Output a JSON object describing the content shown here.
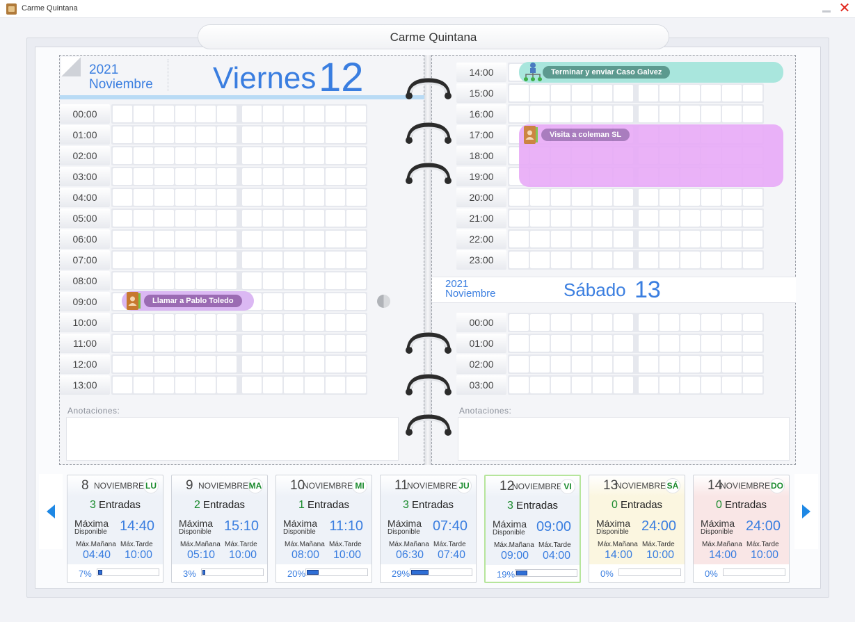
{
  "window": {
    "title": "Carme Quintana",
    "close_glyph": "✕"
  },
  "owner": {
    "name": "Carme Quintana"
  },
  "left_page": {
    "year": "2021",
    "month": "Noviembre",
    "day_name": "Viernes",
    "day_number": "12",
    "slots": [
      "00:00",
      "01:00",
      "02:00",
      "03:00",
      "04:00",
      "05:00",
      "06:00",
      "07:00",
      "08:00",
      "09:00",
      "10:00",
      "11:00",
      "12:00",
      "13:00"
    ],
    "notes_label": "Anotaciones:"
  },
  "right_page": {
    "slots_top": [
      "14:00",
      "15:00",
      "16:00",
      "17:00",
      "18:00",
      "19:00",
      "20:00",
      "21:00",
      "22:00",
      "23:00"
    ],
    "next_day": {
      "year": "2021",
      "month": "Noviembre",
      "day_name": "Sábado",
      "day_number": "13"
    },
    "slots_bottom": [
      "00:00",
      "01:00",
      "02:00",
      "03:00"
    ],
    "notes_label": "Anotaciones:"
  },
  "events": [
    {
      "label": "Llamar a Pablo Toledo",
      "icon": "contact-book-icon",
      "color": "#d9b3f2"
    },
    {
      "label": "Terminar y enviar  Caso Galvez",
      "icon": "org-chart-icon",
      "color": "#a7e5dc"
    },
    {
      "label": "Visita a coleman SL",
      "icon": "contact-book-icon",
      "color": "#e6a6f5"
    }
  ],
  "week": [
    {
      "day": "8",
      "month": "NOVIEMBRE",
      "dow": "LU",
      "entries_count": "3",
      "entries_label": "Entradas",
      "max_label": "Máxima",
      "disp_label": "Disponible",
      "max_time": "14:40",
      "am_label": "Máx.Mañana",
      "pm_label": "Máx.Tarde",
      "am_time": "04:40",
      "pm_time": "10:00",
      "pct": "7%",
      "fill": 0.07,
      "bg": "#eef2f8"
    },
    {
      "day": "9",
      "month": "NOVIEMBRE",
      "dow": "MA",
      "entries_count": "2",
      "entries_label": "Entradas",
      "max_label": "Máxima",
      "disp_label": "Disponible",
      "max_time": "15:10",
      "am_label": "Máx.Mañana",
      "pm_label": "Máx.Tarde",
      "am_time": "05:10",
      "pm_time": "10:00",
      "pct": "3%",
      "fill": 0.03,
      "bg": "#eef2f8"
    },
    {
      "day": "10",
      "month": "NOVIEMBRE",
      "dow": "MI",
      "entries_count": "1",
      "entries_label": "Entradas",
      "max_label": "Máxima",
      "disp_label": "Disponible",
      "max_time": "11:10",
      "am_label": "Máx.Mañana",
      "pm_label": "Máx.Tarde",
      "am_time": "08:00",
      "pm_time": "10:00",
      "pct": "20%",
      "fill": 0.2,
      "bg": "#eef2f8"
    },
    {
      "day": "11",
      "month": "NOVIEMBRE",
      "dow": "JU",
      "entries_count": "3",
      "entries_label": "Entradas",
      "max_label": "Máxima",
      "disp_label": "Disponible",
      "max_time": "07:40",
      "am_label": "Máx.Mañana",
      "pm_label": "Máx.Tarde",
      "am_time": "06:30",
      "pm_time": "07:40",
      "pct": "29%",
      "fill": 0.29,
      "bg": "#eef2f8"
    },
    {
      "day": "12",
      "month": "NOVIEMBRE",
      "dow": "VI",
      "entries_count": "3",
      "entries_label": "Entradas",
      "max_label": "Máxima",
      "disp_label": "Disponible",
      "max_time": "09:00",
      "am_label": "Máx.Mañana",
      "pm_label": "Máx.Tarde",
      "am_time": "09:00",
      "pm_time": "04:00",
      "pct": "19%",
      "fill": 0.19,
      "bg": "#eef2f8",
      "selected": true
    },
    {
      "day": "13",
      "month": "NOVIEMBRE",
      "dow": "SÁ",
      "entries_count": "0",
      "entries_label": "Entradas",
      "max_label": "Máxima",
      "disp_label": "Disponible",
      "max_time": "24:00",
      "am_label": "Máx.Mañana",
      "pm_label": "Máx.Tarde",
      "am_time": "14:00",
      "pm_time": "10:00",
      "pct": "0%",
      "fill": 0,
      "bg": "#fbf6e0"
    },
    {
      "day": "14",
      "month": "NOVIEMBRE",
      "dow": "DO",
      "entries_count": "0",
      "entries_label": "Entradas",
      "max_label": "Máxima",
      "disp_label": "Disponible",
      "max_time": "24:00",
      "am_label": "Máx.Mañana",
      "pm_label": "Máx.Tarde",
      "am_time": "14:00",
      "pm_time": "10:00",
      "pct": "0%",
      "fill": 0,
      "bg": "#f9e6e6"
    }
  ],
  "colors": {
    "accent": "#3a7ee0",
    "count_green": "#1b8b2e",
    "selected_border": "#b6e59c"
  }
}
